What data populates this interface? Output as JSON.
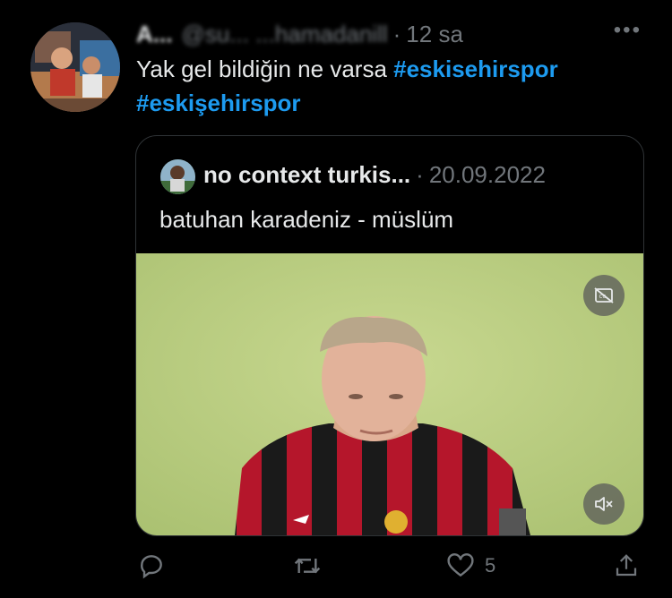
{
  "tweet": {
    "author_name": "A...",
    "author_handle": "@su... ...hamadanill",
    "time": "12 sa",
    "text_prefix": "Yak gel bildiğin ne varsa",
    "hashtags": [
      "#eskisehirspor",
      "#eskişehirspor"
    ]
  },
  "quoted": {
    "author_name": "no context turkis...",
    "date": "20.09.2022",
    "text": "batuhan karadeniz - müslüm"
  },
  "actions": {
    "like_count": "5"
  },
  "colors": {
    "background": "#000000",
    "text": "#e7e9ea",
    "muted": "#71767b",
    "accent": "#1d9bf0",
    "border": "#2f3336"
  },
  "icons": [
    "more-icon",
    "captions-off-icon",
    "mute-icon",
    "reply-icon",
    "retweet-icon",
    "like-icon",
    "share-icon"
  ]
}
